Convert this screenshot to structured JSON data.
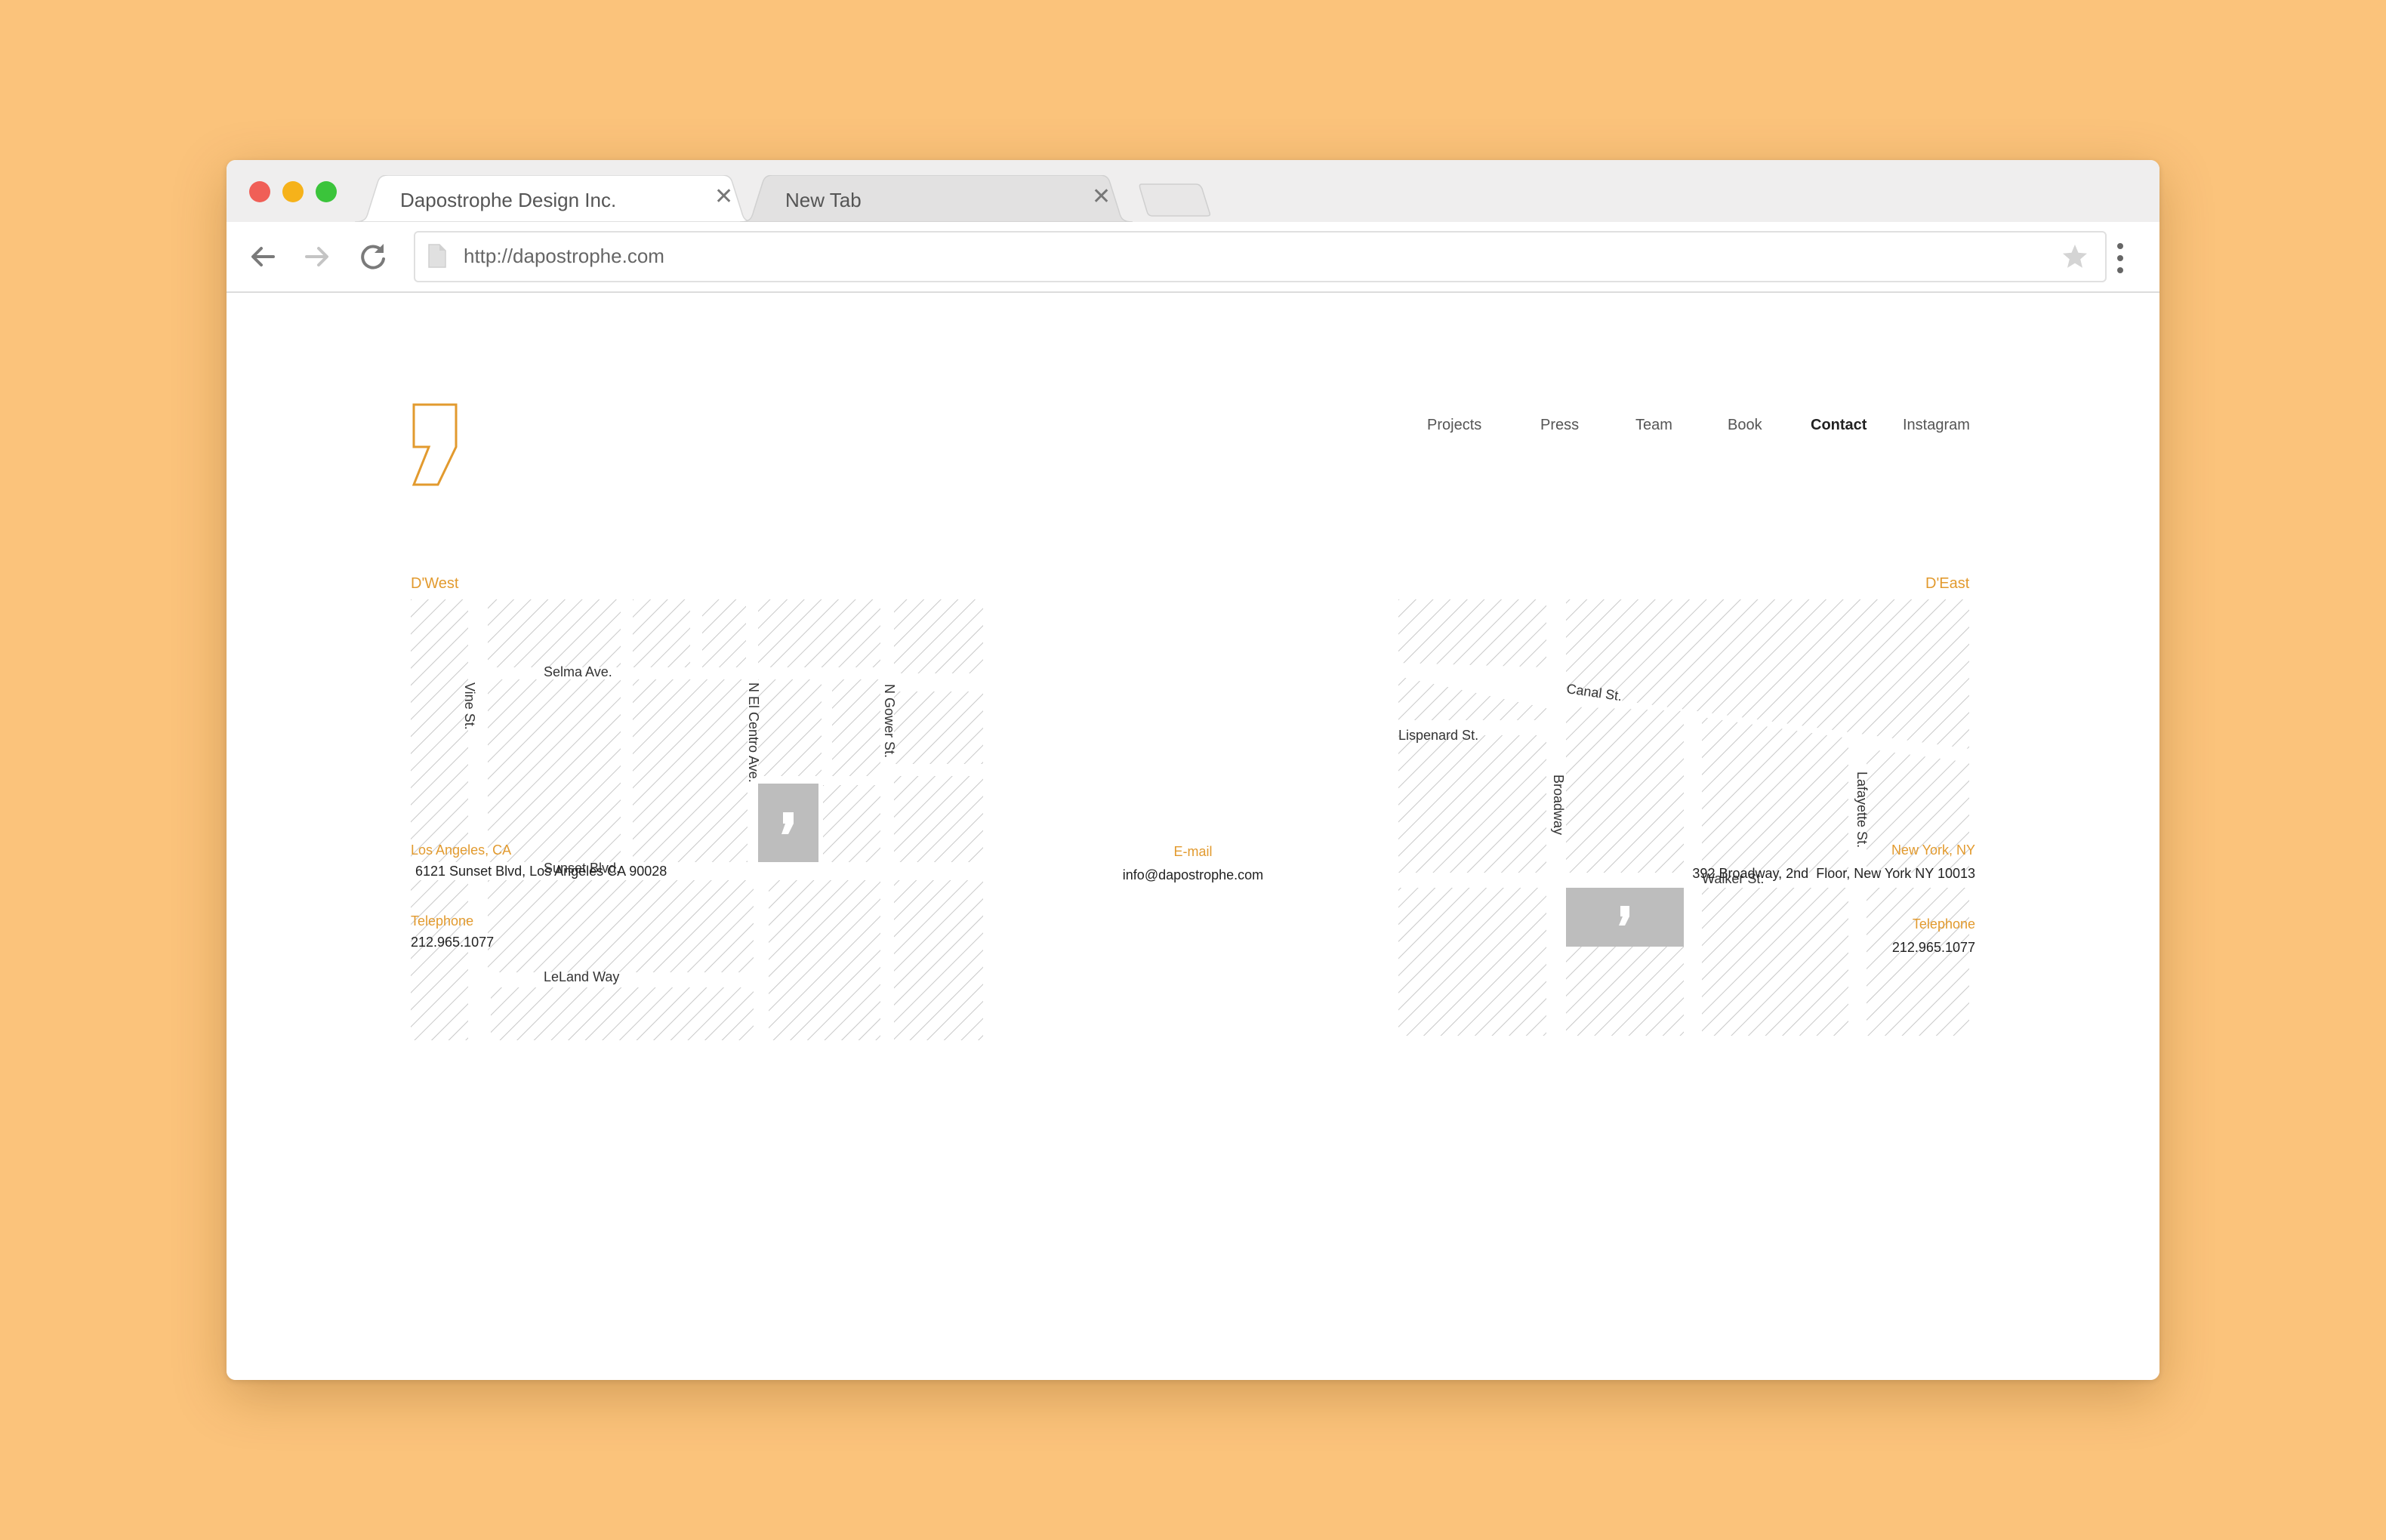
{
  "browser": {
    "tabs": [
      {
        "title": "Dapostrophe Design Inc.",
        "active": true
      },
      {
        "title": "New Tab",
        "active": false
      }
    ],
    "url": "http://dapostrophe.com"
  },
  "nav": {
    "items": [
      "Projects",
      "Press",
      "Team",
      "Book",
      "Contact",
      "Instagram"
    ],
    "active": "Contact"
  },
  "west": {
    "title": "D'West",
    "streets": {
      "vine": "Vine St.",
      "selma": "Selma Ave.",
      "el_centro": "N El Centro Ave.",
      "gower": "N Gower St.",
      "sunset": "Sunset Blvd.",
      "leland": "LeLand Way"
    },
    "city": "Los Angeles, CA",
    "address": "6121 Sunset Blvd, Los Angeles CA 90028",
    "telephone_label": "Telephone",
    "telephone": "212.965.1077"
  },
  "email": {
    "label": "E-mail",
    "value": "info@dapostrophe.com"
  },
  "east": {
    "title": "D'East",
    "streets": {
      "canal": "Canal St.",
      "lispenard": "Lispenard St.",
      "broadway": "Broadway",
      "lafayette": "Lafayette St.",
      "walker": "Walker St."
    },
    "city": "New York, NY",
    "address": "392 Broadway, 2nd  Floor, New York NY 10013",
    "telephone_label": "Telephone",
    "telephone": "212.965.1077"
  },
  "colors": {
    "background": "#FBC37B",
    "accent": "#E29A2E",
    "marker": "#BDBDBD"
  }
}
